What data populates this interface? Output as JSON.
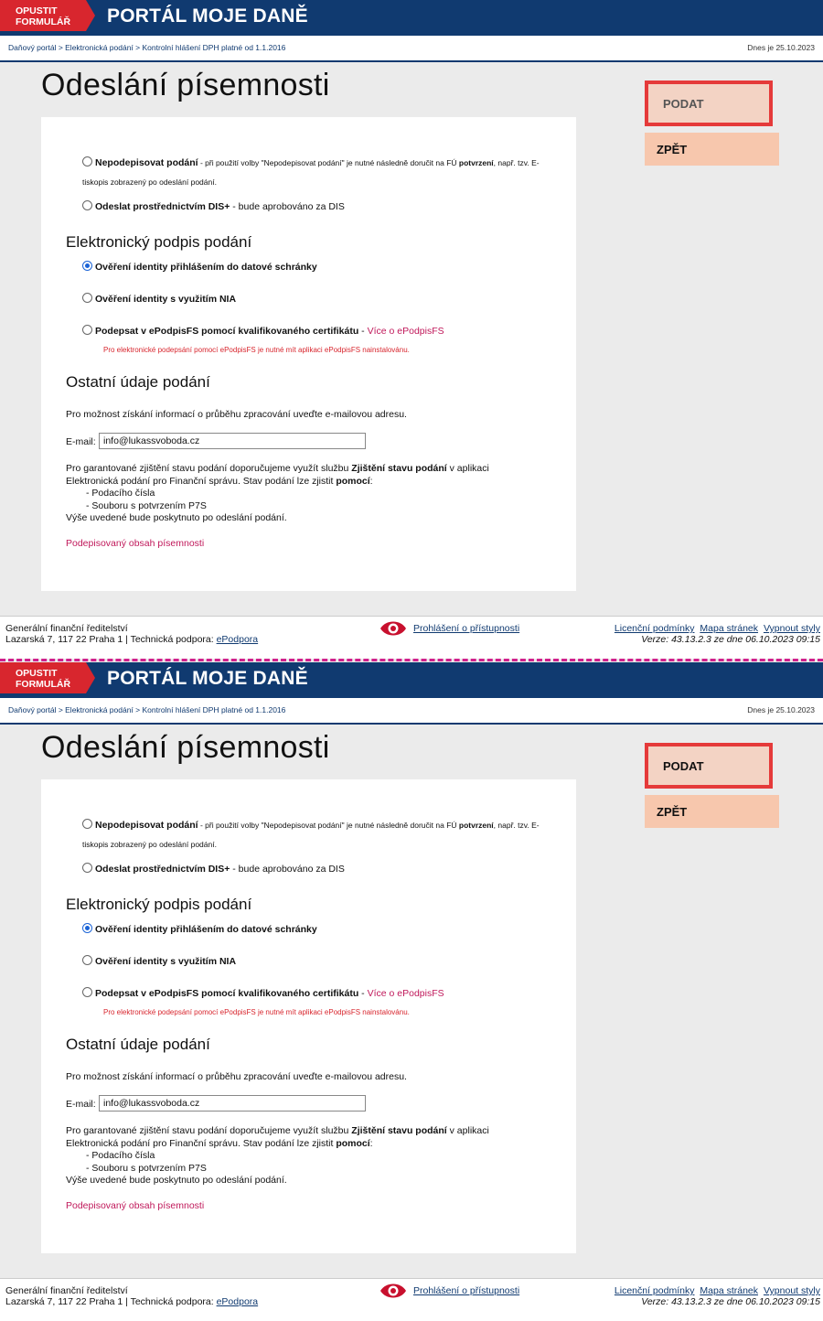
{
  "header": {
    "exit_label_1": "OPUSTIT",
    "exit_label_2": "FORMULÁŘ",
    "portal_title": "PORTÁL MOJE DANĚ"
  },
  "breadcrumb": {
    "items": [
      "Daňový portál",
      "Elektronická podání",
      "Kontrolní hlášení DPH platné od 1.1.2016"
    ],
    "separator": " > ",
    "today": "Dnes je 25.10.2023"
  },
  "page_title": "Odeslání písemnosti",
  "actions": {
    "podat": "PODAT",
    "zpet": "ZPĚT"
  },
  "submission_options": {
    "no_sign_label": "Nepodepisovat podání",
    "no_sign_hint_1": " - při použití volby \"Nepodepisovat podání\" je nutné následně doručit na FÚ ",
    "no_sign_hint_bold": "potvrzení",
    "no_sign_hint_2": ", např. tzv. E-",
    "no_sign_hint_line2": "tiskopis zobrazený po odeslání podání.",
    "dis_label": "Odeslat prostřednictvím DIS+",
    "dis_hint": " - bude aprobováno za DIS"
  },
  "signature": {
    "heading": "Elektronický podpis podání",
    "opt_datova_schranka": "Ověření identity přihlášením do datové schránky",
    "opt_nia": "Ověření identity s využitím NIA",
    "opt_epodpis": "Podepsat v ePodpisFS pomocí kvalifikovaného certifikátu",
    "opt_epodpis_sep": " - ",
    "opt_epodpis_link": "Více o ePodpisFS",
    "warning": "Pro elektronické podepsání pomocí ePodpisFS je nutné mít aplikaci ePodpisFS nainstalovánu.",
    "selected": "datova_schranka"
  },
  "other": {
    "heading": "Ostatní údaje podání",
    "email_info": "Pro možnost získání informací o průběhu zpracování uveďte e-mailovou adresu.",
    "email_label": "E-mail:",
    "email_value": "info@lukassvoboda.cz",
    "status_1": "Pro garantované zjištění stavu podání doporučujeme využít službu ",
    "status_bold": "Zjištění stavu podání",
    "status_2": " v aplikaci",
    "status_3": "Elektronická podání pro Finanční správu. Stav podání lze zjistit ",
    "status_bold2": "pomocí",
    "status_4": ":",
    "item_1": "- Podacího čísla",
    "item_2": "- Souboru s potvrzením P7S",
    "after_send": "Výše uvedené bude poskytnuto po odeslání podání.",
    "signed_content_link": "Podepisovaný obsah písemnosti"
  },
  "footer": {
    "org_name": "Generální finanční ředitelství",
    "address": "Lazarská 7, 117 22 Praha 1 | Technická podpora: ",
    "support_link": "ePodpora",
    "accessibility": "Prohlášení o přístupnosti",
    "links": [
      "Licenční podmínky",
      "Mapa stránek",
      "Vypnout styly"
    ],
    "version": "Verze: 43.13.2.3 ze dne 06.10.2023 09:15"
  },
  "colors": {
    "header_blue": "#103a70",
    "exit_red": "#d8262e",
    "podat_border": "#e53a3a",
    "link_red": "#c0185a"
  }
}
